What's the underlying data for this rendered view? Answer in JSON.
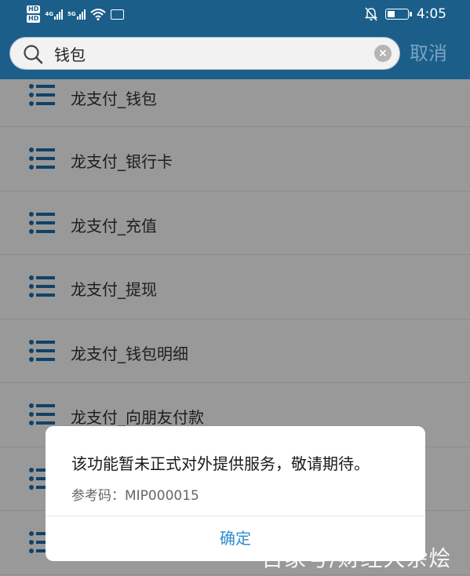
{
  "status_bar": {
    "hd_badge_1": "HD",
    "hd_badge_2": "HD",
    "network_1": "4G",
    "network_2": "5G",
    "time": "4:05",
    "battery_level": 0.4
  },
  "search": {
    "value": "钱包",
    "cancel_label": "取消"
  },
  "list": {
    "items": [
      {
        "label": "龙支付_钱包"
      },
      {
        "label": "龙支付_银行卡"
      },
      {
        "label": "龙支付_充值"
      },
      {
        "label": "龙支付_提现"
      },
      {
        "label": "龙支付_钱包明细"
      },
      {
        "label": "龙支付_向朋友付款"
      },
      {
        "label": ""
      },
      {
        "label": ""
      }
    ]
  },
  "dialog": {
    "message": "该功能暂未正式对外提供服务，敬请期待。",
    "ref_label": "参考码：MIP000015",
    "confirm_label": "确定"
  },
  "watermark": "百家号/财经大杂烩",
  "colors": {
    "header": "#1b5e8a",
    "icon_blue": "#1b6fb0",
    "confirm": "#2f8fd0",
    "cancel": "#7aa3c4"
  }
}
